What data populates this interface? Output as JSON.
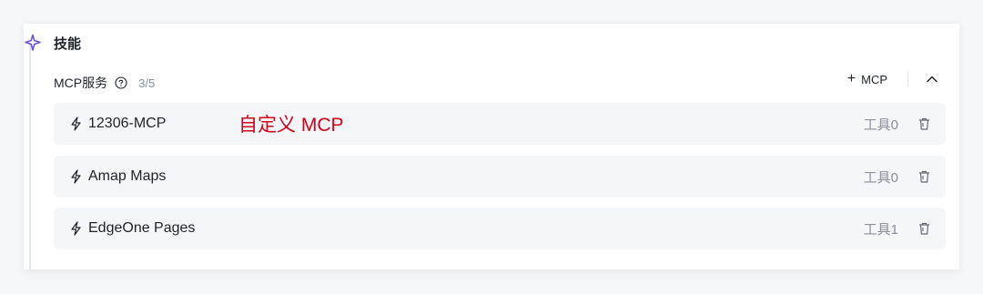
{
  "skills": {
    "title": "技能",
    "icon": "sparkle-icon"
  },
  "mcp": {
    "title": "MCP服务",
    "help_icon": "help-circle-icon",
    "count": "3/5",
    "add_label": "MCP",
    "add_icon": "plus-icon",
    "collapse_icon": "chevron-up-icon",
    "custom_label": "自定义 MCP",
    "rows": [
      {
        "name": "12306-MCP",
        "tools": "工具0",
        "icon": "bolt-icon",
        "delete_icon": "trash-icon"
      },
      {
        "name": "Amap Maps",
        "tools": "工具0",
        "icon": "bolt-icon",
        "delete_icon": "trash-icon"
      },
      {
        "name": "EdgeOne Pages",
        "tools": "工具1",
        "icon": "bolt-icon",
        "delete_icon": "trash-icon"
      }
    ]
  },
  "colors": {
    "accent_purple": "#6b4fd8",
    "annotation_red": "#d0021b",
    "row_bg": "#f5f6f7"
  }
}
